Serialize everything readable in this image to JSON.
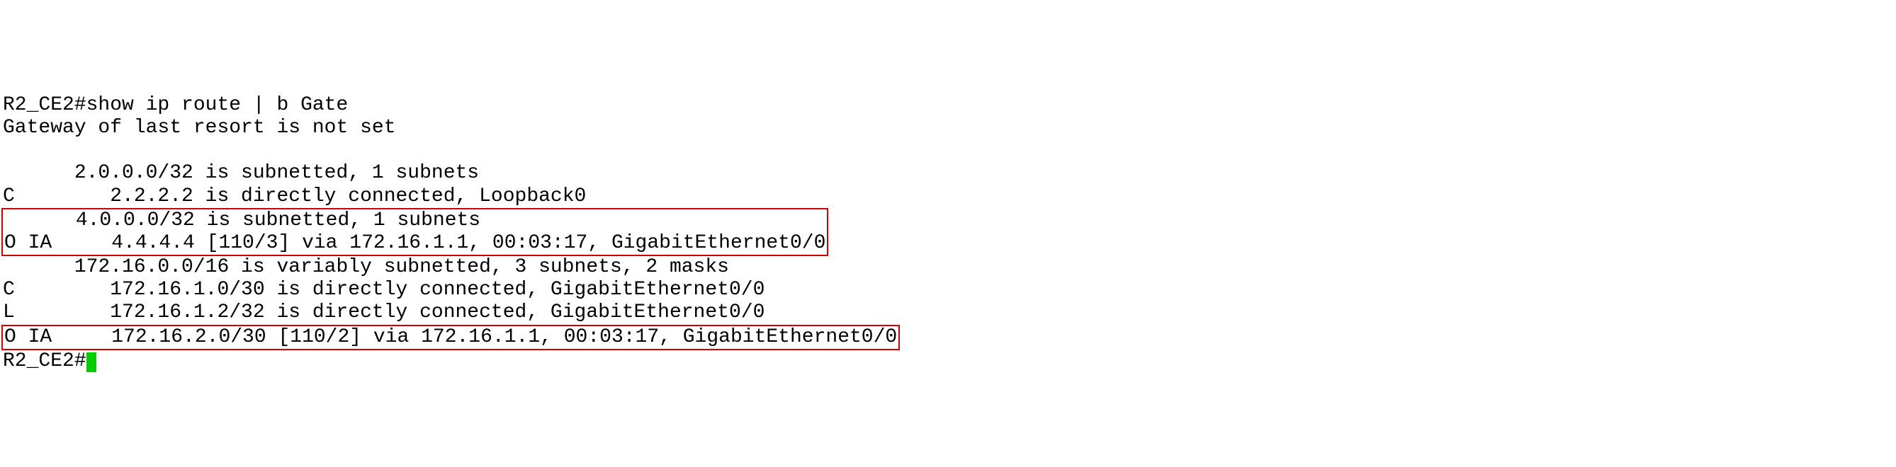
{
  "prompt_line": "R2_CE2#show ip route | b Gate",
  "gateway_line": "Gateway of last resort is not set",
  "routes": {
    "net1_header": "      2.0.0.0/32 is subnetted, 1 subnets",
    "net1_route1": "C        2.2.2.2 is directly connected, Loopback0",
    "net2_header": "      4.0.0.0/32 is subnetted, 1 subnets",
    "net2_route1": "O IA     4.4.4.4 [110/3] via 172.16.1.1, 00:03:17, GigabitEthernet0/0",
    "net3_header": "      172.16.0.0/16 is variably subnetted, 3 subnets, 2 masks",
    "net3_route1": "C        172.16.1.0/30 is directly connected, GigabitEthernet0/0",
    "net3_route2": "L        172.16.1.2/32 is directly connected, GigabitEthernet0/0",
    "net3_route3": "O IA     172.16.2.0/30 [110/2] via 172.16.1.1, 00:03:17, GigabitEthernet0/0"
  },
  "end_prompt": "R2_CE2#"
}
